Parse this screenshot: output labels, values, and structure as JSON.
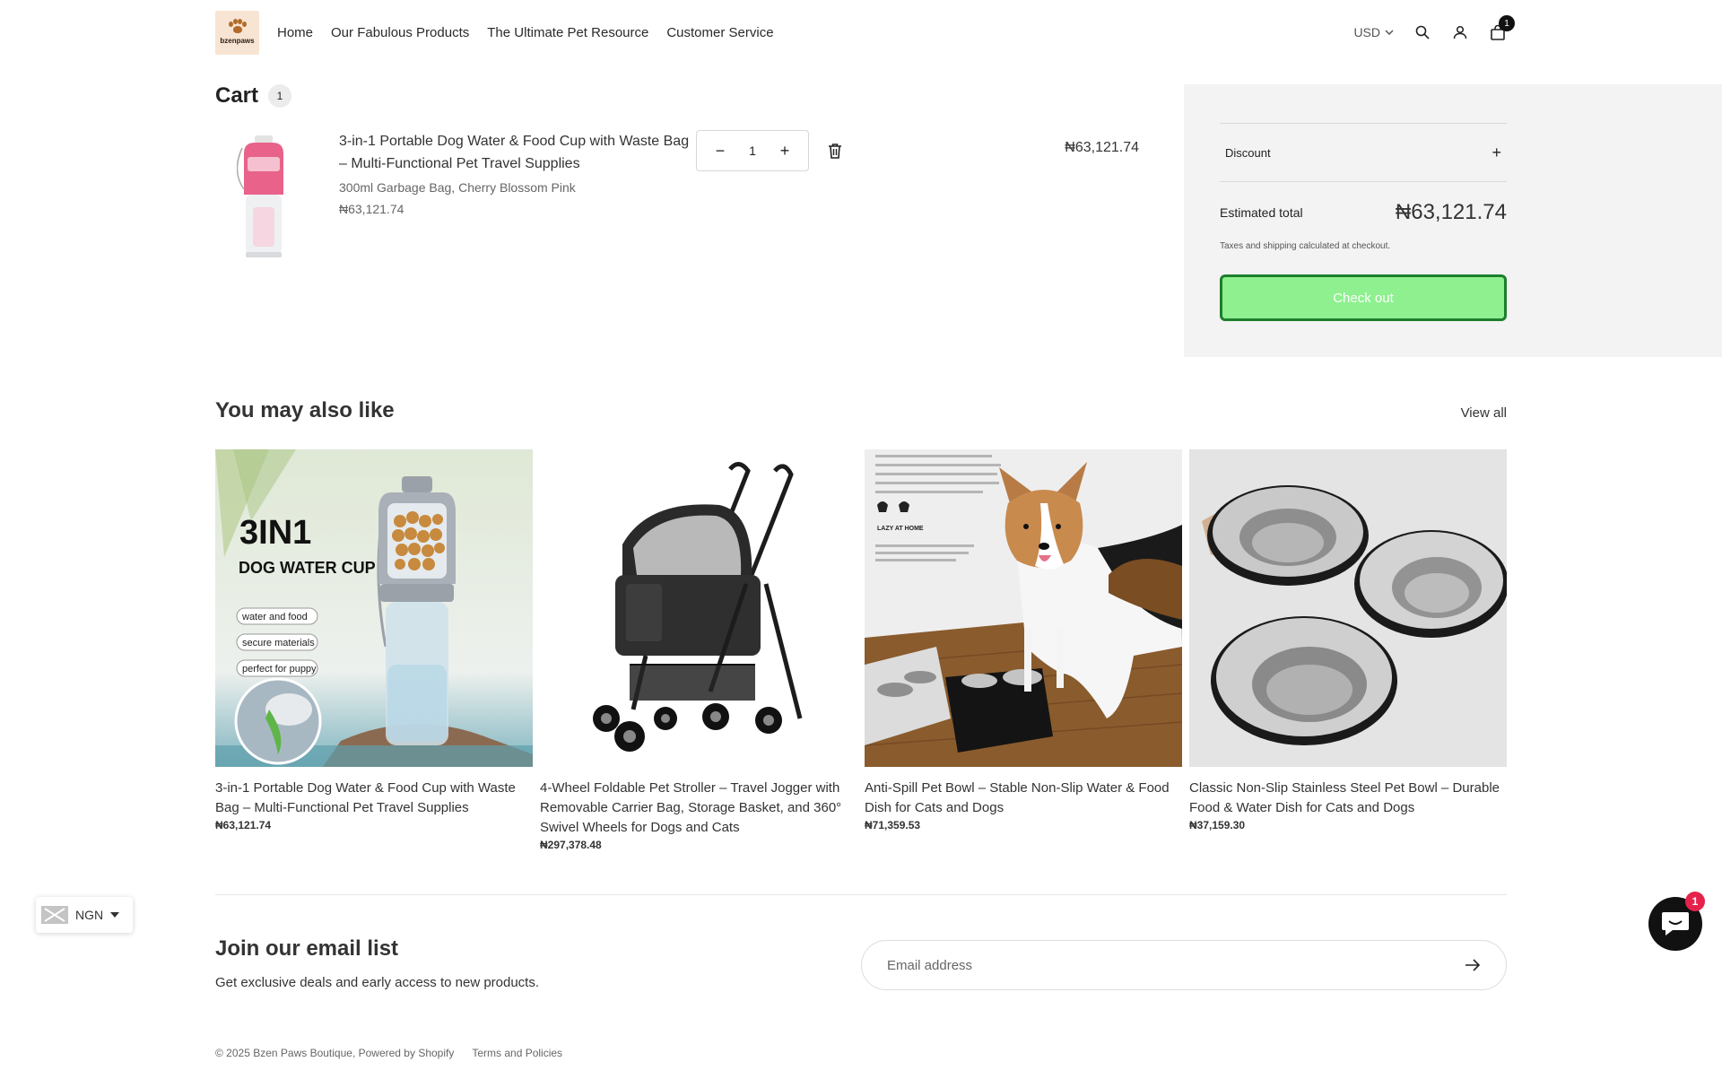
{
  "brand": {
    "logo_text": "bzenpaws"
  },
  "nav": {
    "items": [
      "Home",
      "Our Fabulous Products",
      "The Ultimate Pet Resource",
      "Customer Service"
    ]
  },
  "header": {
    "currency": "USD",
    "cart_count": "1"
  },
  "cart": {
    "title": "Cart",
    "count": "1",
    "item": {
      "title": "3-in-1 Portable Dog Water & Food Cup with Waste Bag – Multi-Functional Pet Travel Supplies",
      "variant": "300ml Garbage Bag, Cherry Blossom Pink",
      "price": "₦63,121.74",
      "quantity": "1",
      "line_total": "₦63,121.74"
    }
  },
  "summary": {
    "discount_label": "Discount",
    "estimated_label": "Estimated total",
    "estimated_value": "₦63,121.74",
    "tax_note": "Taxes and shipping calculated at checkout.",
    "checkout_label": "Check out",
    "checkout_color": "#8ef08f"
  },
  "recommendations": {
    "title": "You may also like",
    "view_all": "View all",
    "products": [
      {
        "title": "3-in-1 Portable Dog Water & Food Cup with Waste Bag – Multi-Functional Pet Travel Supplies",
        "price": "₦63,121.74",
        "image_text": [
          "3IN1",
          "DOG WATER CUP",
          "water and food",
          "secure materials",
          "perfect for puppy"
        ]
      },
      {
        "title": "4-Wheel Foldable Pet Stroller – Travel Jogger with Removable Carrier Bag, Storage Basket, and 360° Swivel Wheels for Dogs and Cats",
        "price": "₦297,378.48"
      },
      {
        "title": "Anti-Spill Pet Bowl – Stable Non-Slip Water & Food Dish for Cats and Dogs",
        "price": "₦71,359.53",
        "image_text": [
          "LAZY AT HOME"
        ]
      },
      {
        "title": "Classic Non-Slip Stainless Steel Pet Bowl – Durable Food & Water Dish for Cats and Dogs",
        "price": "₦37,159.30"
      }
    ]
  },
  "newsletter": {
    "title": "Join our email list",
    "subtitle": "Get exclusive deals and early access to new products.",
    "placeholder": "Email address"
  },
  "footer": {
    "copyright": "© 2025 Bzen Paws Boutique, Powered by Shopify",
    "policies": "Terms and Policies"
  },
  "currency_selector": {
    "code": "NGN"
  },
  "chat": {
    "badge": "1"
  }
}
